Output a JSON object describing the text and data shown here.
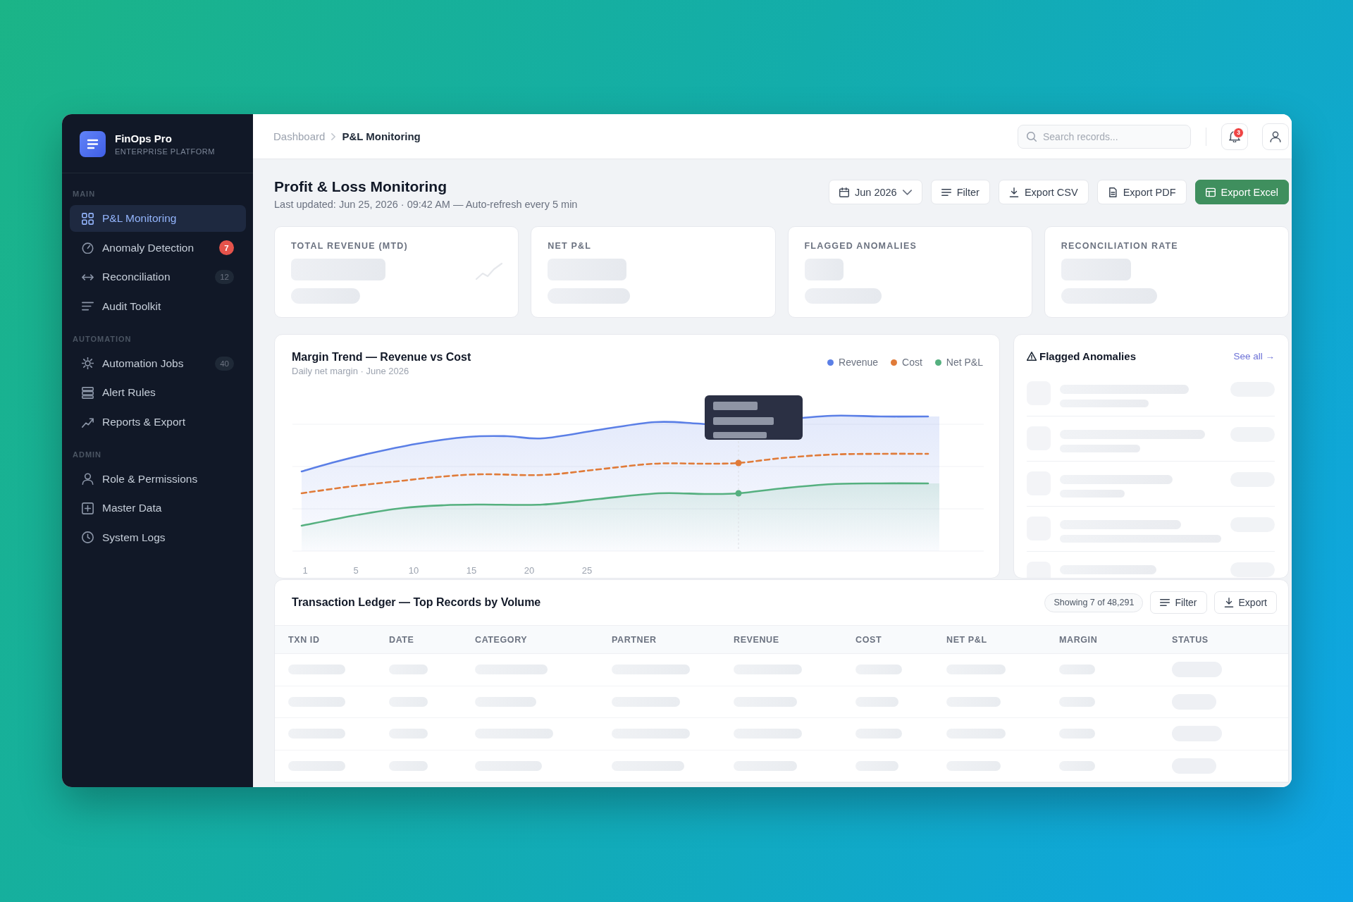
{
  "sidebar": {
    "brand": {
      "name": "FinOps Pro",
      "tagline": "ENTERPRISE PLATFORM"
    },
    "sections": [
      {
        "label": "MAIN",
        "items": [
          {
            "label": "P&L Monitoring",
            "selected": true
          },
          {
            "label": "Anomaly Detection",
            "selected": false,
            "badge": {
              "text": "7",
              "kind": "alert"
            }
          },
          {
            "label": "Reconciliation",
            "selected": false,
            "badge": {
              "text": "12",
              "kind": "count"
            }
          },
          {
            "label": "Audit Toolkit",
            "selected": false
          }
        ]
      },
      {
        "label": "AUTOMATION",
        "items": [
          {
            "label": "Automation Jobs",
            "selected": false,
            "badge": {
              "text": "40",
              "kind": "count"
            }
          },
          {
            "label": "Alert Rules",
            "selected": false
          },
          {
            "label": "Reports & Export",
            "selected": false
          }
        ]
      },
      {
        "label": "ADMIN",
        "items": [
          {
            "label": "Role & Permissions",
            "selected": false
          },
          {
            "label": "Master Data",
            "selected": false
          },
          {
            "label": "System Logs",
            "selected": false
          }
        ]
      }
    ]
  },
  "header": {
    "breadcrumb": [
      "Dashboard",
      "P&L Monitoring"
    ],
    "search": {
      "placeholder": "Search records..."
    },
    "notifications": {
      "count": "3"
    }
  },
  "page": {
    "title": "Profit & Loss Monitoring",
    "subtitle": "Last updated: Jun 25, 2026 · 09:42 AM — Auto-refresh every 5 min",
    "actions": [
      {
        "label": "Jun 2026",
        "kind": "dropdown"
      },
      {
        "label": "Filter",
        "kind": "secondary"
      },
      {
        "label": "Export CSV",
        "kind": "secondary"
      },
      {
        "label": "Export PDF",
        "kind": "secondary"
      },
      {
        "label": "Export Excel",
        "kind": "primary"
      }
    ]
  },
  "kpis": [
    {
      "label": "TOTAL REVENUE (MTD)"
    },
    {
      "label": "NET P&L"
    },
    {
      "label": "FLAGGED ANOMALIES"
    },
    {
      "label": "RECONCILIATION RATE"
    }
  ],
  "chart": {
    "title": "Margin Trend — Revenue vs Cost",
    "subtitle": "Daily net margin · June 2026",
    "legend": [
      {
        "label": "Revenue",
        "color": "#5b7fe6"
      },
      {
        "label": "Cost",
        "color": "#e07b39"
      },
      {
        "label": "Net P&L",
        "color": "#55b07f"
      }
    ],
    "x_labels": [
      "1",
      "5",
      "10",
      "15",
      "20",
      "25"
    ]
  },
  "anomalies": {
    "title": "Flagged Anomalies",
    "link": "See all →"
  },
  "ledger": {
    "title": "Transaction Ledger — Top Records by Volume",
    "count": "Showing 7 of 48,291",
    "actions": [
      {
        "label": "Filter"
      },
      {
        "label": "Export"
      }
    ],
    "columns": [
      "TXN ID",
      "DATE",
      "CATEGORY",
      "PARTNER",
      "REVENUE",
      "COST",
      "NET P&L",
      "MARGIN",
      "STATUS"
    ]
  }
}
